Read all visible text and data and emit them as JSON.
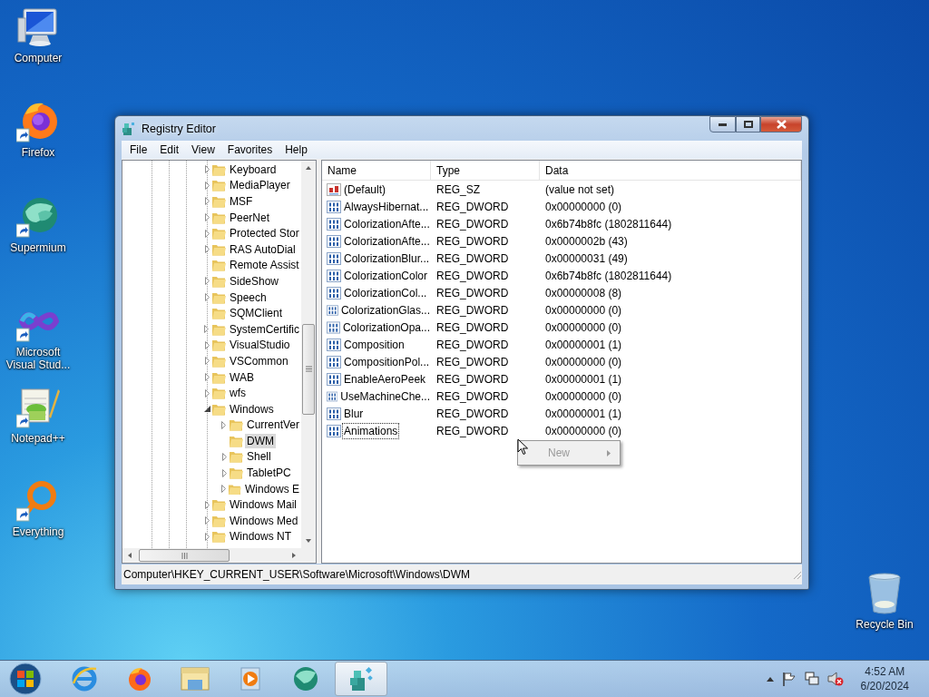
{
  "desktop_icons": [
    {
      "kind": "computer",
      "label": "Computer"
    },
    {
      "kind": "firefox",
      "label": "Firefox"
    },
    {
      "kind": "supermium",
      "label": "Supermium"
    },
    {
      "kind": "visualstudio",
      "label": "Microsoft Visual Stud..."
    },
    {
      "kind": "notepad",
      "label": "Notepad++"
    },
    {
      "kind": "everything",
      "label": "Everything"
    },
    {
      "kind": "recycle",
      "label": "Recycle Bin"
    }
  ],
  "window": {
    "title": "Registry Editor",
    "menu": [
      "File",
      "Edit",
      "View",
      "Favorites",
      "Help"
    ],
    "tree": [
      {
        "label": "Keyboard",
        "expandable": true,
        "expanded": false,
        "selected": false
      },
      {
        "label": "MediaPlayer",
        "expandable": true,
        "expanded": false,
        "selected": false
      },
      {
        "label": "MSF",
        "expandable": true,
        "expanded": false,
        "selected": false
      },
      {
        "label": "PeerNet",
        "expandable": true,
        "expanded": false,
        "selected": false
      },
      {
        "label": "Protected Stor",
        "expandable": true,
        "expanded": false,
        "selected": false
      },
      {
        "label": "RAS AutoDial",
        "expandable": true,
        "expanded": false,
        "selected": false
      },
      {
        "label": "Remote Assist",
        "expandable": false,
        "expanded": false,
        "selected": false
      },
      {
        "label": "SideShow",
        "expandable": true,
        "expanded": false,
        "selected": false
      },
      {
        "label": "Speech",
        "expandable": true,
        "expanded": false,
        "selected": false
      },
      {
        "label": "SQMClient",
        "expandable": false,
        "expanded": false,
        "selected": false
      },
      {
        "label": "SystemCertific",
        "expandable": true,
        "expanded": false,
        "selected": false
      },
      {
        "label": "VisualStudio",
        "expandable": true,
        "expanded": false,
        "selected": false
      },
      {
        "label": "VSCommon",
        "expandable": true,
        "expanded": false,
        "selected": false
      },
      {
        "label": "WAB",
        "expandable": true,
        "expanded": false,
        "selected": false
      },
      {
        "label": "wfs",
        "expandable": true,
        "expanded": false,
        "selected": false
      },
      {
        "label": "Windows",
        "expandable": true,
        "expanded": true,
        "selected": false,
        "children": [
          {
            "label": "CurrentVer",
            "expandable": true,
            "expanded": false,
            "selected": false
          },
          {
            "label": "DWM",
            "expandable": false,
            "expanded": false,
            "selected": true
          },
          {
            "label": "Shell",
            "expandable": true,
            "expanded": false,
            "selected": false
          },
          {
            "label": "TabletPC",
            "expandable": true,
            "expanded": false,
            "selected": false
          },
          {
            "label": "Windows E",
            "expandable": true,
            "expanded": false,
            "selected": false
          }
        ]
      },
      {
        "label": "Windows Mail",
        "expandable": true,
        "expanded": false,
        "selected": false
      },
      {
        "label": "Windows Med",
        "expandable": true,
        "expanded": false,
        "selected": false
      },
      {
        "label": "Windows NT",
        "expandable": true,
        "expanded": false,
        "selected": false
      }
    ],
    "columns": [
      "Name",
      "Type",
      "Data"
    ],
    "values": [
      {
        "kind": "string",
        "name": "(Default)",
        "type": "REG_SZ",
        "data": "(value not set)",
        "focused": false
      },
      {
        "kind": "binary",
        "name": "AlwaysHibernat...",
        "type": "REG_DWORD",
        "data": "0x00000000 (0)",
        "focused": false
      },
      {
        "kind": "binary",
        "name": "ColorizationAfte...",
        "type": "REG_DWORD",
        "data": "0x6b74b8fc (1802811644)",
        "focused": false
      },
      {
        "kind": "binary",
        "name": "ColorizationAfte...",
        "type": "REG_DWORD",
        "data": "0x0000002b (43)",
        "focused": false
      },
      {
        "kind": "binary",
        "name": "ColorizationBlur...",
        "type": "REG_DWORD",
        "data": "0x00000031 (49)",
        "focused": false
      },
      {
        "kind": "binary",
        "name": "ColorizationColor",
        "type": "REG_DWORD",
        "data": "0x6b74b8fc (1802811644)",
        "focused": false
      },
      {
        "kind": "binary",
        "name": "ColorizationCol...",
        "type": "REG_DWORD",
        "data": "0x00000008 (8)",
        "focused": false
      },
      {
        "kind": "binary",
        "name": "ColorizationGlas...",
        "type": "REG_DWORD",
        "data": "0x00000000 (0)",
        "focused": false
      },
      {
        "kind": "binary",
        "name": "ColorizationOpa...",
        "type": "REG_DWORD",
        "data": "0x00000000 (0)",
        "focused": false
      },
      {
        "kind": "binary",
        "name": "Composition",
        "type": "REG_DWORD",
        "data": "0x00000001 (1)",
        "focused": false
      },
      {
        "kind": "binary",
        "name": "CompositionPol...",
        "type": "REG_DWORD",
        "data": "0x00000000 (0)",
        "focused": false
      },
      {
        "kind": "binary",
        "name": "EnableAeroPeek",
        "type": "REG_DWORD",
        "data": "0x00000001 (1)",
        "focused": false
      },
      {
        "kind": "binary",
        "name": "UseMachineChe...",
        "type": "REG_DWORD",
        "data": "0x00000000 (0)",
        "focused": false
      },
      {
        "kind": "binary",
        "name": "Blur",
        "type": "REG_DWORD",
        "data": "0x00000001 (1)",
        "focused": false
      },
      {
        "kind": "binary",
        "name": "Animations",
        "type": "REG_DWORD",
        "data": "0x00000000 (0)",
        "focused": true
      }
    ],
    "context_menu": [
      {
        "label": "New",
        "disabled": true,
        "submenu": true
      }
    ],
    "status_bar": "Computer\\HKEY_CURRENT_USER\\Software\\Microsoft\\Windows\\DWM"
  },
  "taskbar": {
    "apps": [
      {
        "kind": "ie",
        "active": false
      },
      {
        "kind": "firefox",
        "active": false
      },
      {
        "kind": "explorer",
        "active": false
      },
      {
        "kind": "media",
        "active": false
      },
      {
        "kind": "supermium",
        "active": false
      },
      {
        "kind": "regedit",
        "active": true
      }
    ],
    "time": "4:52 AM",
    "date": "6/20/2024"
  }
}
